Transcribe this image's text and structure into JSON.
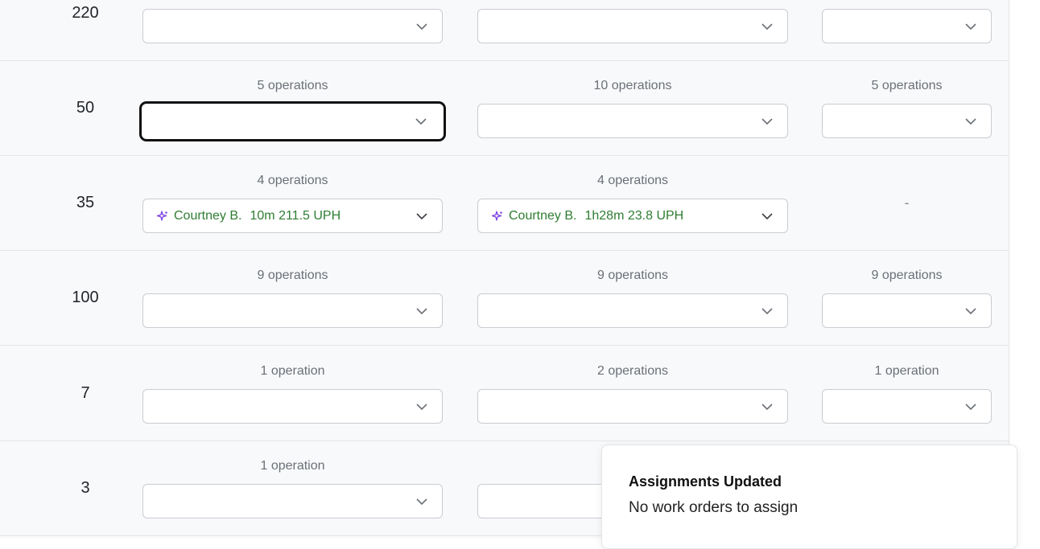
{
  "rows": [
    {
      "quantity": "220",
      "cells": [
        {
          "ops": "",
          "value": ""
        },
        {
          "ops": "",
          "value": ""
        },
        {
          "ops": "",
          "value": ""
        }
      ]
    },
    {
      "quantity": "50",
      "cells": [
        {
          "ops": "5 operations",
          "value": ""
        },
        {
          "ops": "10 operations",
          "value": ""
        },
        {
          "ops": "5 operations",
          "value": ""
        }
      ]
    },
    {
      "quantity": "35",
      "cells": [
        {
          "ops": "4 operations",
          "name": "Courtney B.",
          "time": "10m",
          "rate": "211.5 UPH"
        },
        {
          "ops": "4 operations",
          "name": "Courtney B.",
          "time": "1h28m",
          "rate": "23.8 UPH"
        },
        {
          "ops": "",
          "empty": "-"
        }
      ]
    },
    {
      "quantity": "100",
      "cells": [
        {
          "ops": "9 operations",
          "value": ""
        },
        {
          "ops": "9 operations",
          "value": ""
        },
        {
          "ops": "9 operations",
          "value": ""
        }
      ]
    },
    {
      "quantity": "7",
      "cells": [
        {
          "ops": "1 operation",
          "value": ""
        },
        {
          "ops": "2 operations",
          "value": ""
        },
        {
          "ops": "1 operation",
          "value": ""
        }
      ]
    },
    {
      "quantity": "3",
      "cells": [
        {
          "ops": "1 operation",
          "value": ""
        },
        {
          "ops": "",
          "value": ""
        }
      ]
    }
  ],
  "toast": {
    "title": "Assignments Updated",
    "message": "No work orders to assign"
  },
  "colors": {
    "assignee_text": "#2e7d32",
    "sparkle_icon": "#7b3fe4",
    "focus_border": "#111111"
  },
  "icons": {
    "dropdown": "chevron-down-icon",
    "suggestion": "sparkle-icon"
  }
}
